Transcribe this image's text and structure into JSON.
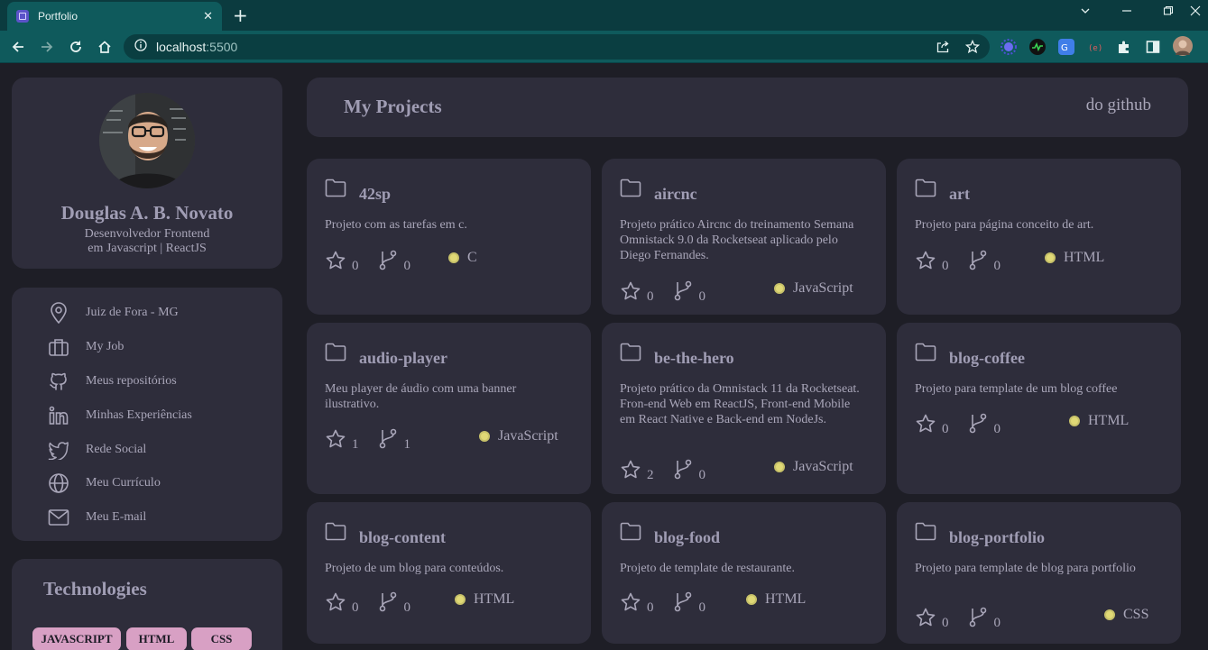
{
  "browser": {
    "tab_title": "Portfolio",
    "tab_close": "✕",
    "new_tab": "+",
    "url_host": "localhost",
    "url_port": ":5500"
  },
  "profile": {
    "name": "Douglas A. B. Novato",
    "role_line1": "Desenvolvedor Frontend",
    "role_line2": "em Javascript | ReactJS"
  },
  "links": [
    {
      "label": "Juiz de Fora - MG",
      "icon": "map-pin-icon"
    },
    {
      "label": "My Job",
      "icon": "briefcase-icon"
    },
    {
      "label": "Meus repositórios",
      "icon": "github-icon"
    },
    {
      "label": "Minhas Experiências",
      "icon": "linkedin-icon"
    },
    {
      "label": "Rede Social",
      "icon": "twitter-icon"
    },
    {
      "label": "Meu Currículo",
      "icon": "globe-icon"
    },
    {
      "label": "Meu E-mail",
      "icon": "mail-icon"
    }
  ],
  "technologies": {
    "title": "Technologies",
    "badges": [
      "JAVASCRIPT",
      "HTML",
      "CSS"
    ]
  },
  "header": {
    "title": "My Projects",
    "link": "do github"
  },
  "projects": [
    {
      "name": "42sp",
      "desc": "Projeto com as tarefas em c.",
      "stars": "0",
      "forks": "0",
      "lang": "C"
    },
    {
      "name": "aircnc",
      "desc": "Projeto prático Aircnc do treinamento Semana Omnistack 9.0 da Rocketseat aplicado pelo Diego Fernandes.",
      "stars": "0",
      "forks": "0",
      "lang": "JavaScript"
    },
    {
      "name": "art",
      "desc": "Projeto para página conceito de art.",
      "stars": "0",
      "forks": "0",
      "lang": "HTML"
    },
    {
      "name": "audio-player",
      "desc": "Meu player de áudio com uma banner ilustrativo.",
      "stars": "1",
      "forks": "1",
      "lang": "JavaScript"
    },
    {
      "name": "be-the-hero",
      "desc": "Projeto prático da Omnistack 11 da Rocketseat. Fron-end Web em ReactJS, Front-end Mobile em React Native e Back-end em NodeJs.",
      "stars": "2",
      "forks": "0",
      "lang": "JavaScript"
    },
    {
      "name": "blog-coffee",
      "desc": "Projeto para template de um blog coffee",
      "stars": "0",
      "forks": "0",
      "lang": "HTML"
    },
    {
      "name": "blog-content",
      "desc": "Projeto de um blog para conteúdos.",
      "stars": "0",
      "forks": "0",
      "lang": "HTML"
    },
    {
      "name": "blog-food",
      "desc": "Projeto de template de restaurante.",
      "stars": "0",
      "forks": "0",
      "lang": "HTML"
    },
    {
      "name": "blog-portfolio",
      "desc": "Projeto para template de blog para portfolio",
      "stars": "0",
      "forks": "0",
      "lang": "CSS"
    }
  ],
  "colors": {
    "background": "#1e1e26",
    "card": "#2e2d3b",
    "badge": "#d8a0c4",
    "lang_dot": "#e0d976",
    "browser_toolbar": "#0f5a5c"
  }
}
